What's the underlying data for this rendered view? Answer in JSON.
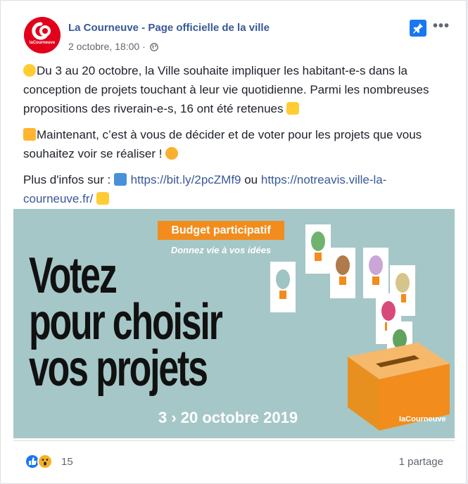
{
  "post": {
    "page_name": "La Courneuve - Page officielle de la ville",
    "avatar_brand": "laCourneuve",
    "date": "2 octobre, 18:00",
    "meta_separator": "·",
    "paragraph1_text": "Du 3 au 20 octobre, la Ville souhaite impliquer les habitant-e-s dans la conception de projets touchant à leur vie quotidienne. Parmi les nombreuses propositions des riverain-e-s, 16 ont été retenues",
    "paragraph2_text": "Maintenant, c’est à vous de décider et de voter pour les projets que vous souhaitez voir se réaliser !",
    "paragraph3_prefix": "Plus d'infos sur : ",
    "link1": "https://bit.ly/2pcZMf9",
    "connector": " ou ",
    "link2": "https://notreavis.ville-la-courneuve.fr/",
    "icons": [
      "hugging-face-emoji",
      "clapping-hands-emoji",
      "pointing-right-emoji",
      "star-struck-emoji",
      "play-arrow-emoji",
      "victory-hand-emoji",
      "globe-icon",
      "pin-icon",
      "more-icon"
    ]
  },
  "banner": {
    "badge": "Budget participatif",
    "subtitle": "Donnez vie à vos idées",
    "headline_line1": "Votez",
    "headline_line2": "pour choisir",
    "headline_line3": "vos projets",
    "dates": "3 › 20 octobre 2019",
    "brand": "laCourneuve",
    "accent_color": "#f28c1d",
    "background_color": "#a6c7c7"
  },
  "footer": {
    "reaction_count": "15",
    "shares": "1 partage"
  }
}
